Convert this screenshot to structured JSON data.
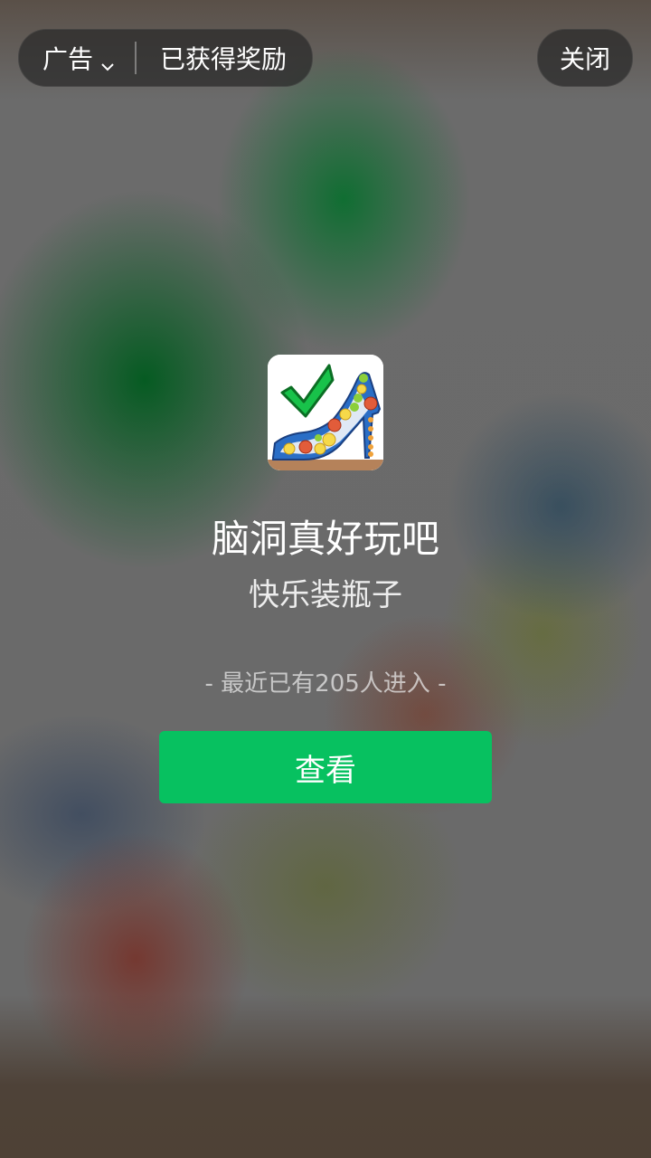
{
  "top_bar": {
    "ad_label": "广告",
    "reward_text": "已获得奖励",
    "close_label": "关闭"
  },
  "app": {
    "icon": "high-heel-bottle-game-icon",
    "name": "脑洞真好玩吧",
    "subtitle": "快乐装瓶子",
    "visitors_text": "- 最近已有205人进入 -"
  },
  "cta": {
    "label": "查看",
    "color": "#07c160"
  }
}
